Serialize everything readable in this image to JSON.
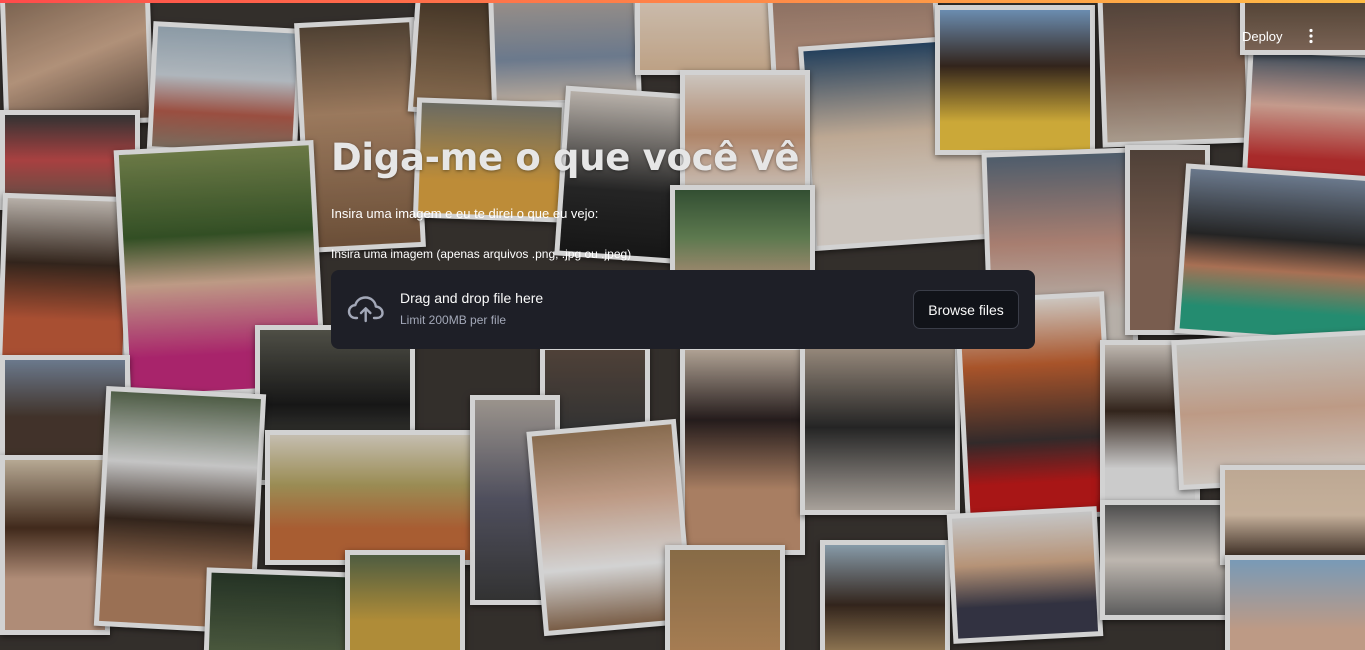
{
  "header": {
    "deploy_label": "Deploy",
    "menu_icon": "vertical-dots-icon",
    "decoration_colors": [
      "#ff4b4b",
      "#ffbd45"
    ]
  },
  "main": {
    "title": "Diga-me o que você vê",
    "subtitle": "Insira uma imagem e eu te direi o que eu vejo:",
    "uploader": {
      "label": "Insira uma imagem (apenas arquivos .png, .jpg ou .jpeg)",
      "drop_text": "Drag and drop file here",
      "limit_text": "Limit 200MB per file",
      "browse_label": "Browse files",
      "icon": "cloud-upload-icon"
    }
  },
  "background": {
    "description_icon": "photo-collage",
    "accent": "#1e1f27"
  }
}
